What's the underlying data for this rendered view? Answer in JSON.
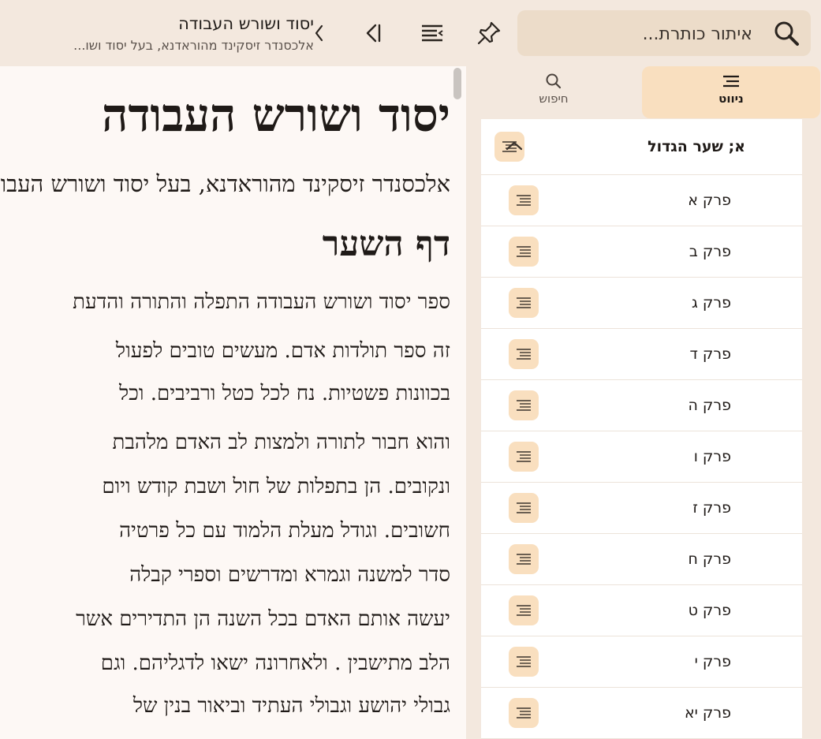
{
  "toolbar": {
    "search_placeholder": "איתור כותרת...",
    "book_title": "יסוד ושורש העבודה",
    "book_subtitle": "אלכסנדר זיסקינד מהוראדנא, בעל יסוד ושו..."
  },
  "sidebar": {
    "tabs": [
      {
        "label": "ניווט",
        "icon": "lines-icon",
        "active": true
      },
      {
        "label": "חיפוש",
        "icon": "search-icon",
        "active": false
      }
    ],
    "section_header": "א; שער הגדול",
    "chapters": [
      "פרק א",
      "פרק ב",
      "פרק ג",
      "פרק ד",
      "פרק ה",
      "פרק ו",
      "פרק ז",
      "פרק ח",
      "פרק ט",
      "פרק י",
      "פרק יא"
    ]
  },
  "reader": {
    "title": "יסוד ושורש העבודה",
    "author": "אלכסנדר זיסקינד מהוראדנא, בעל יסוד ושורש העבודה",
    "page_title": "דף השער",
    "lines": [
      "ספר יסוד ושורש העבודה התפלה והתורה והדעת",
      "זה ספר תולדות אדם. מעשים טובים לפעול",
      "בכוונות פשטיות. נח לכל כטל ורביבים. וכל",
      "והוא חבור לתורה ולמצות לב האדם מלהבת",
      "ונקובים. הן בתפלות של חול ושבת קודש ויום",
      "חשובים. וגודל מעלת הלמוד עם כל פרטיה",
      "סדר למשנה וגמרא ומדרשים וספרי קבלה",
      "יעשה אותם האדם בכל השנה הן התדירים אשר",
      "הלב מתישבין . ולאחרונה ישאו לדגליהם. וגם",
      "גבולי יהושע וגבולי העתיד וביאור בנין של"
    ]
  },
  "colors": {
    "background": "#f3e8de",
    "accent": "#f9dfbf",
    "search_field": "#ecdcc9",
    "reader_bg": "#fdf8f5"
  }
}
